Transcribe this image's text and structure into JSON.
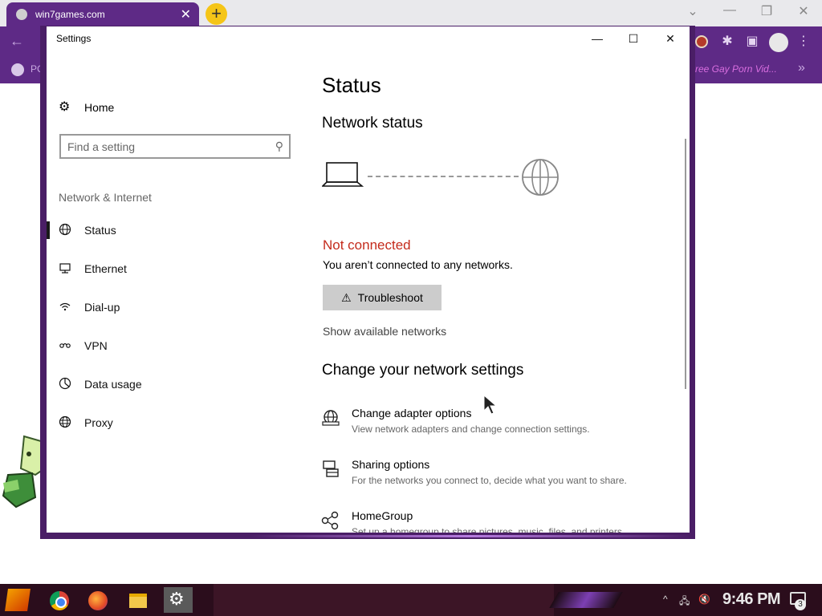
{
  "browser": {
    "tab_title": "win7games.com",
    "tab_close": "✕",
    "new_tab": "+",
    "bookmark_left": "PC",
    "bookmark_right": "ree Gay Porn Vid...",
    "bookmark_more": "»",
    "controls": {
      "tabs_list": "⌄",
      "minimize": "—",
      "restore": "❐",
      "close": "✕"
    },
    "accent_color": "#5e2a86"
  },
  "window": {
    "title": "Settings",
    "minimize": "—",
    "maximize": "☐",
    "close": "✕"
  },
  "sidebar": {
    "home_label": "Home",
    "home_icon": "gear-icon",
    "search_placeholder": "Find a setting",
    "section_label": "Network & Internet",
    "items": [
      {
        "label": "Status",
        "icon": "globe-icon",
        "selected": true
      },
      {
        "label": "Ethernet",
        "icon": "ethernet-icon",
        "selected": false
      },
      {
        "label": "Dial-up",
        "icon": "dialup-icon",
        "selected": false
      },
      {
        "label": "VPN",
        "icon": "vpn-icon",
        "selected": false
      },
      {
        "label": "Data usage",
        "icon": "data-usage-icon",
        "selected": false
      },
      {
        "label": "Proxy",
        "icon": "proxy-icon",
        "selected": false
      }
    ]
  },
  "main": {
    "title": "Status",
    "network_status_heading": "Network status",
    "status_text": "Not connected",
    "status_color": "#c42b1c",
    "status_description": "You aren’t connected to any networks.",
    "troubleshoot_label": "Troubleshoot",
    "show_networks_link": "Show available networks",
    "change_heading": "Change your network settings",
    "options": [
      {
        "title": "Change adapter options",
        "desc": "View network adapters and change connection settings.",
        "icon": "adapter-icon"
      },
      {
        "title": "Sharing options",
        "desc": "For the networks you connect to, decide what you want to share.",
        "icon": "sharing-icon"
      },
      {
        "title": "HomeGroup",
        "desc": "Set up a homegroup to share pictures, music, files, and printers.",
        "icon": "homegroup-icon"
      }
    ]
  },
  "taskbar": {
    "clock": "9:46 PM",
    "notification_count": "3",
    "tray_up": "^",
    "tray_network": "🖧",
    "tray_volume": "🔇"
  }
}
